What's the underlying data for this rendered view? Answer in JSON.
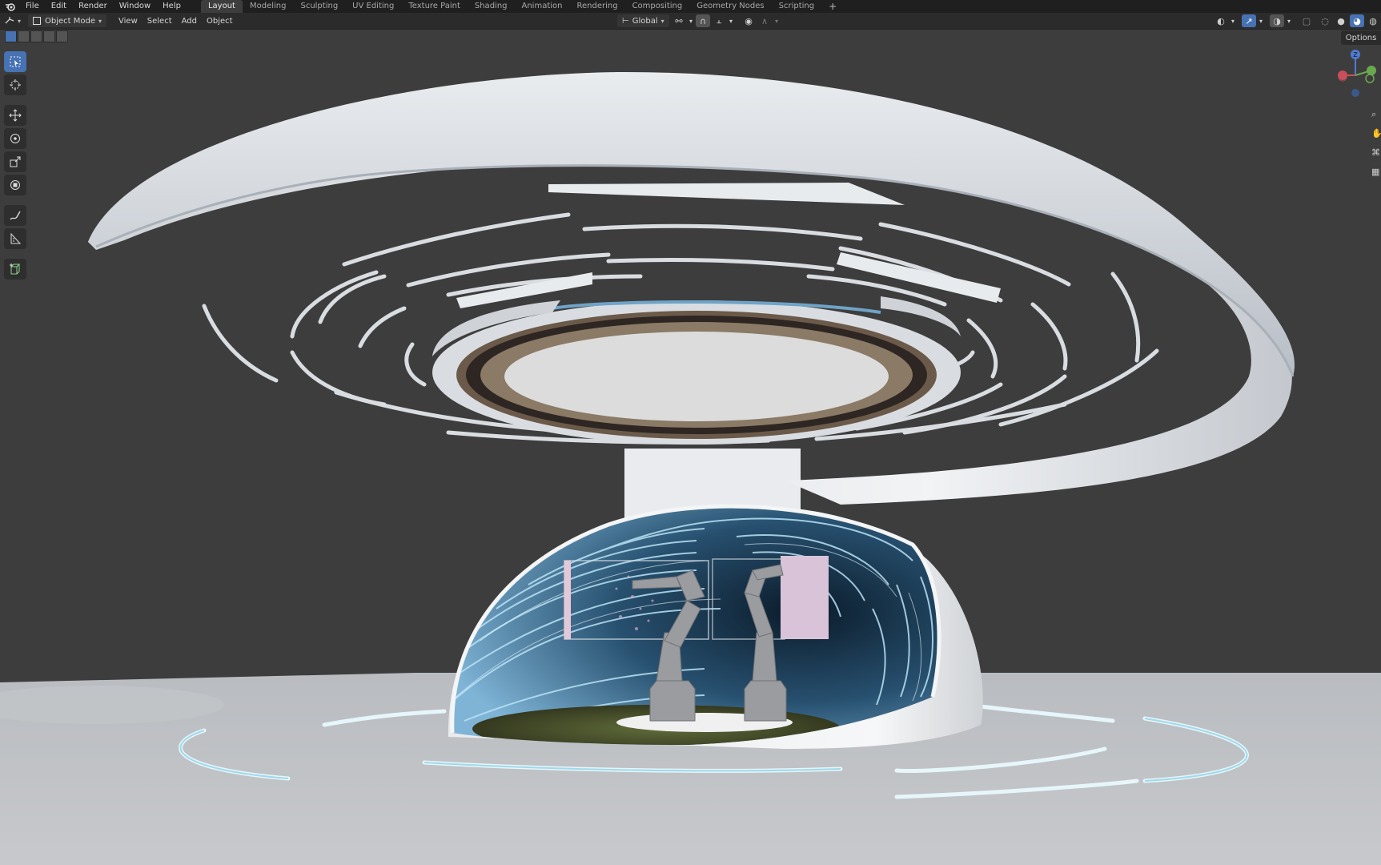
{
  "topbar": {
    "logo": "blender-logo-icon",
    "menus": [
      "File",
      "Edit",
      "Render",
      "Window",
      "Help"
    ],
    "workspaces": [
      "Layout",
      "Modeling",
      "Sculpting",
      "UV Editing",
      "Texture Paint",
      "Shading",
      "Animation",
      "Rendering",
      "Compositing",
      "Geometry Nodes",
      "Scripting"
    ],
    "active_workspace": "Layout",
    "add_workspace": "+"
  },
  "header": {
    "editor_type_icon": "3d-viewport-icon",
    "mode": "Object Mode",
    "menus": [
      "View",
      "Select",
      "Add",
      "Object"
    ],
    "transform_orientation": "Global",
    "options_label": "Options"
  },
  "toolbar": {
    "tools": [
      "select-box-icon",
      "cursor-icon",
      "move-icon",
      "rotate-icon",
      "scale-icon",
      "transform-icon",
      "annotate-icon",
      "measure-icon",
      "add-cube-icon"
    ],
    "active_tool": "select-box-icon"
  },
  "gizmo": {
    "z_label": "Z",
    "y_label": "Y",
    "x_label": "X"
  },
  "colors": {
    "topbar_bg": "#1f1f1f",
    "header_bg": "#2b2b2b",
    "viewport_bg": "#3d3d3d",
    "accent": "#4772b3",
    "axis_x": "#c84f5b",
    "axis_y": "#6aa84f",
    "axis_z": "#4e7bd3"
  }
}
